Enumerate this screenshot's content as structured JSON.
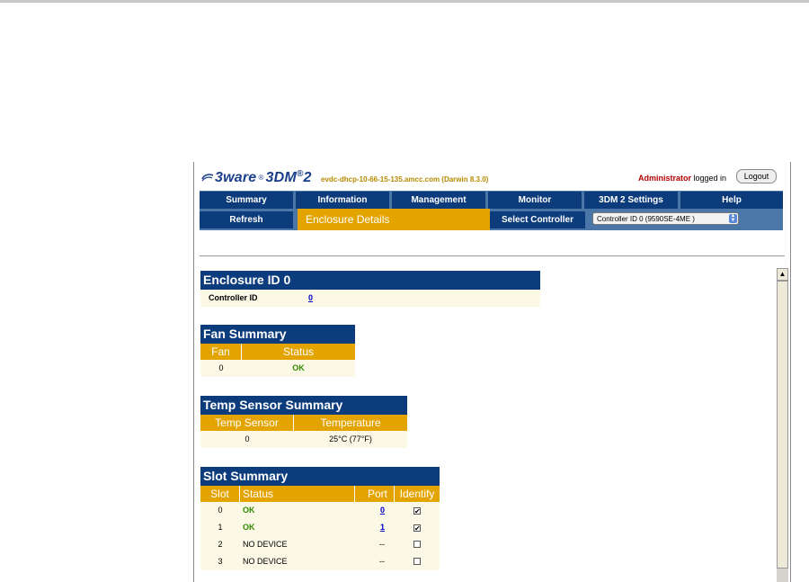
{
  "app": {
    "logo_brand": "3ware",
    "logo_product": "3DM",
    "logo_version": "2",
    "hostname": "evdc-dhcp-10-66-15-135.amcc.com (Darwin 8.3.0)",
    "user_role": "Administrator",
    "login_status": "logged in",
    "logout_label": "Logout"
  },
  "nav": {
    "items": [
      "Summary",
      "Information",
      "Management",
      "Monitor",
      "3DM 2 Settings",
      "Help"
    ],
    "refresh_label": "Refresh",
    "page_title": "Enclosure Details",
    "select_label": "Select Controller",
    "controller_selected": "Controller ID 0 (9590SE-4ME )"
  },
  "enclosure": {
    "title": "Enclosure ID 0",
    "controller_label": "Controller ID",
    "controller_value": "0"
  },
  "fan_summary": {
    "title": "Fan Summary",
    "headers": [
      "Fan",
      "Status"
    ],
    "rows": [
      {
        "fan": "0",
        "status": "OK"
      }
    ]
  },
  "temp_summary": {
    "title": "Temp Sensor Summary",
    "headers": [
      "Temp Sensor",
      "Temperature"
    ],
    "rows": [
      {
        "sensor": "0",
        "temperature": "25°C (77°F)"
      }
    ]
  },
  "slot_summary": {
    "title": "Slot Summary",
    "headers": [
      "Slot",
      "Status",
      "Port",
      "Identify"
    ],
    "rows": [
      {
        "slot": "0",
        "status": "OK",
        "port": "0",
        "identify": true
      },
      {
        "slot": "1",
        "status": "OK",
        "port": "1",
        "identify": true
      },
      {
        "slot": "2",
        "status": "NO DEVICE",
        "port": "--",
        "identify": false
      },
      {
        "slot": "3",
        "status": "NO DEVICE",
        "port": "--",
        "identify": false
      }
    ]
  },
  "colors": {
    "nav_blue": "#0d3c7c",
    "accent_orange": "#e3a400",
    "ok_green": "#2e8a00",
    "admin_red": "#b40000"
  }
}
